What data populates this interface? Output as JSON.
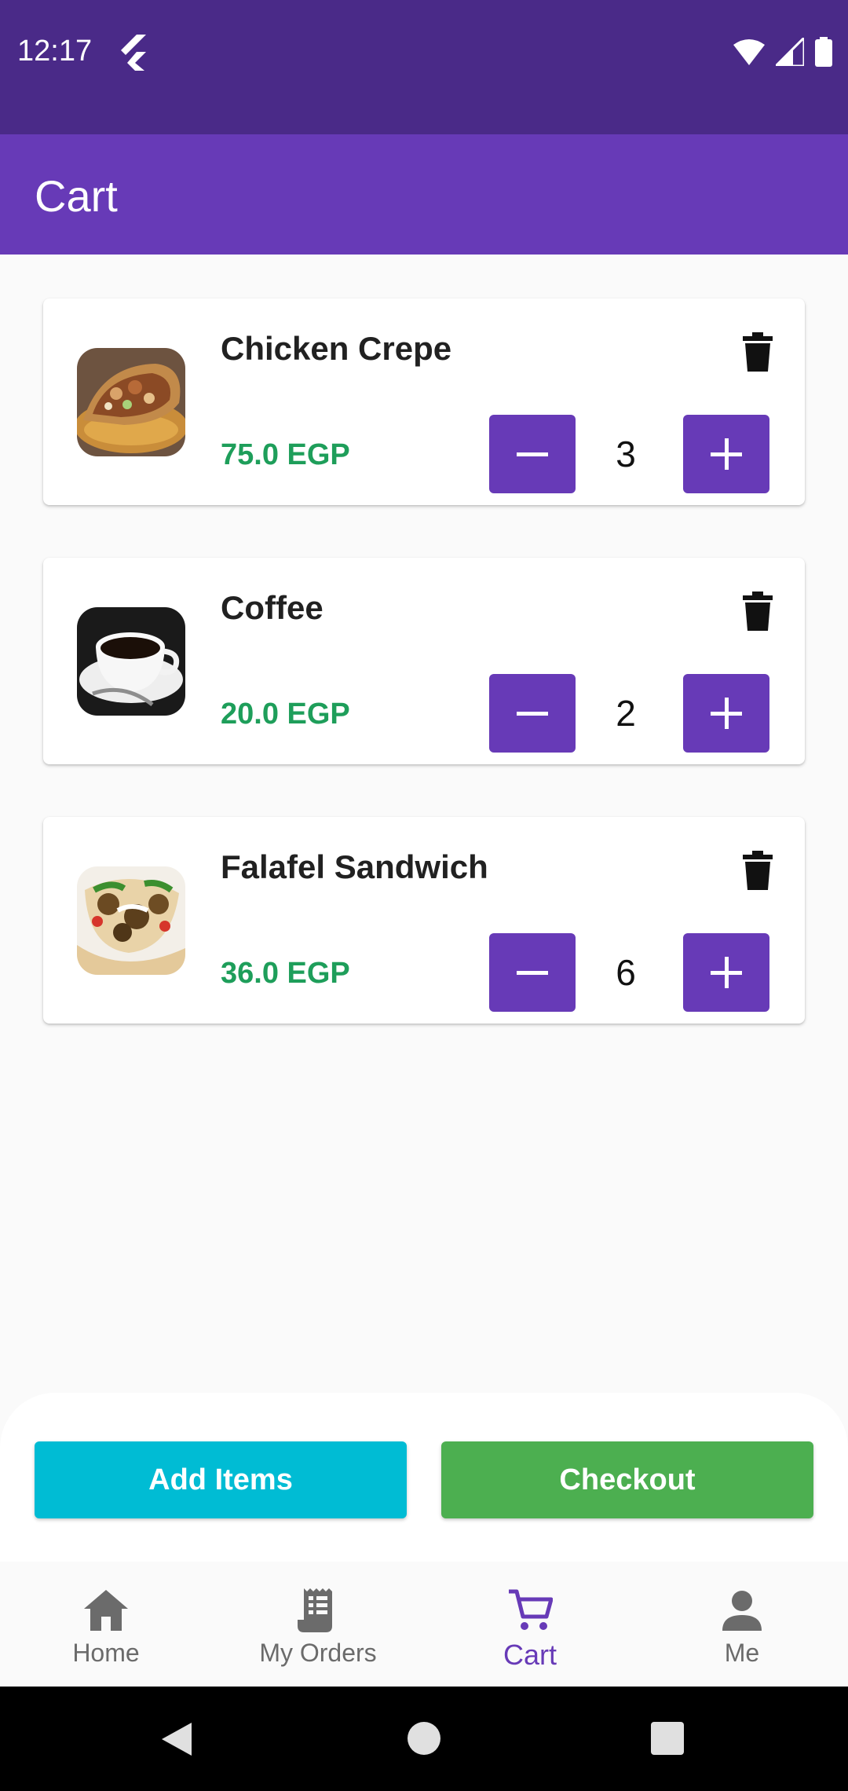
{
  "status_bar": {
    "time": "12:17"
  },
  "app_bar": {
    "title": "Cart"
  },
  "cart": {
    "items": [
      {
        "name": "Chicken Crepe",
        "price": "75.0 EGP",
        "quantity": "3",
        "image": "chicken-crepe"
      },
      {
        "name": "Coffee",
        "price": "20.0 EGP",
        "quantity": "2",
        "image": "coffee-cup"
      },
      {
        "name": "Falafel Sandwich",
        "price": "36.0 EGP",
        "quantity": "6",
        "image": "falafel-sandwich"
      }
    ]
  },
  "actions": {
    "add_items_label": "Add Items",
    "checkout_label": "Checkout"
  },
  "bottom_nav": {
    "items": [
      {
        "label": "Home",
        "icon": "home-icon",
        "active": false
      },
      {
        "label": "My Orders",
        "icon": "receipt-icon",
        "active": false
      },
      {
        "label": "Cart",
        "icon": "cart-icon",
        "active": true
      },
      {
        "label": "Me",
        "icon": "person-icon",
        "active": false
      }
    ]
  },
  "colors": {
    "primary": "#673ab7",
    "status_bar": "#4a2a88",
    "price": "#1e9e5a",
    "add_items": "#00bcd4",
    "checkout": "#4caf50"
  }
}
